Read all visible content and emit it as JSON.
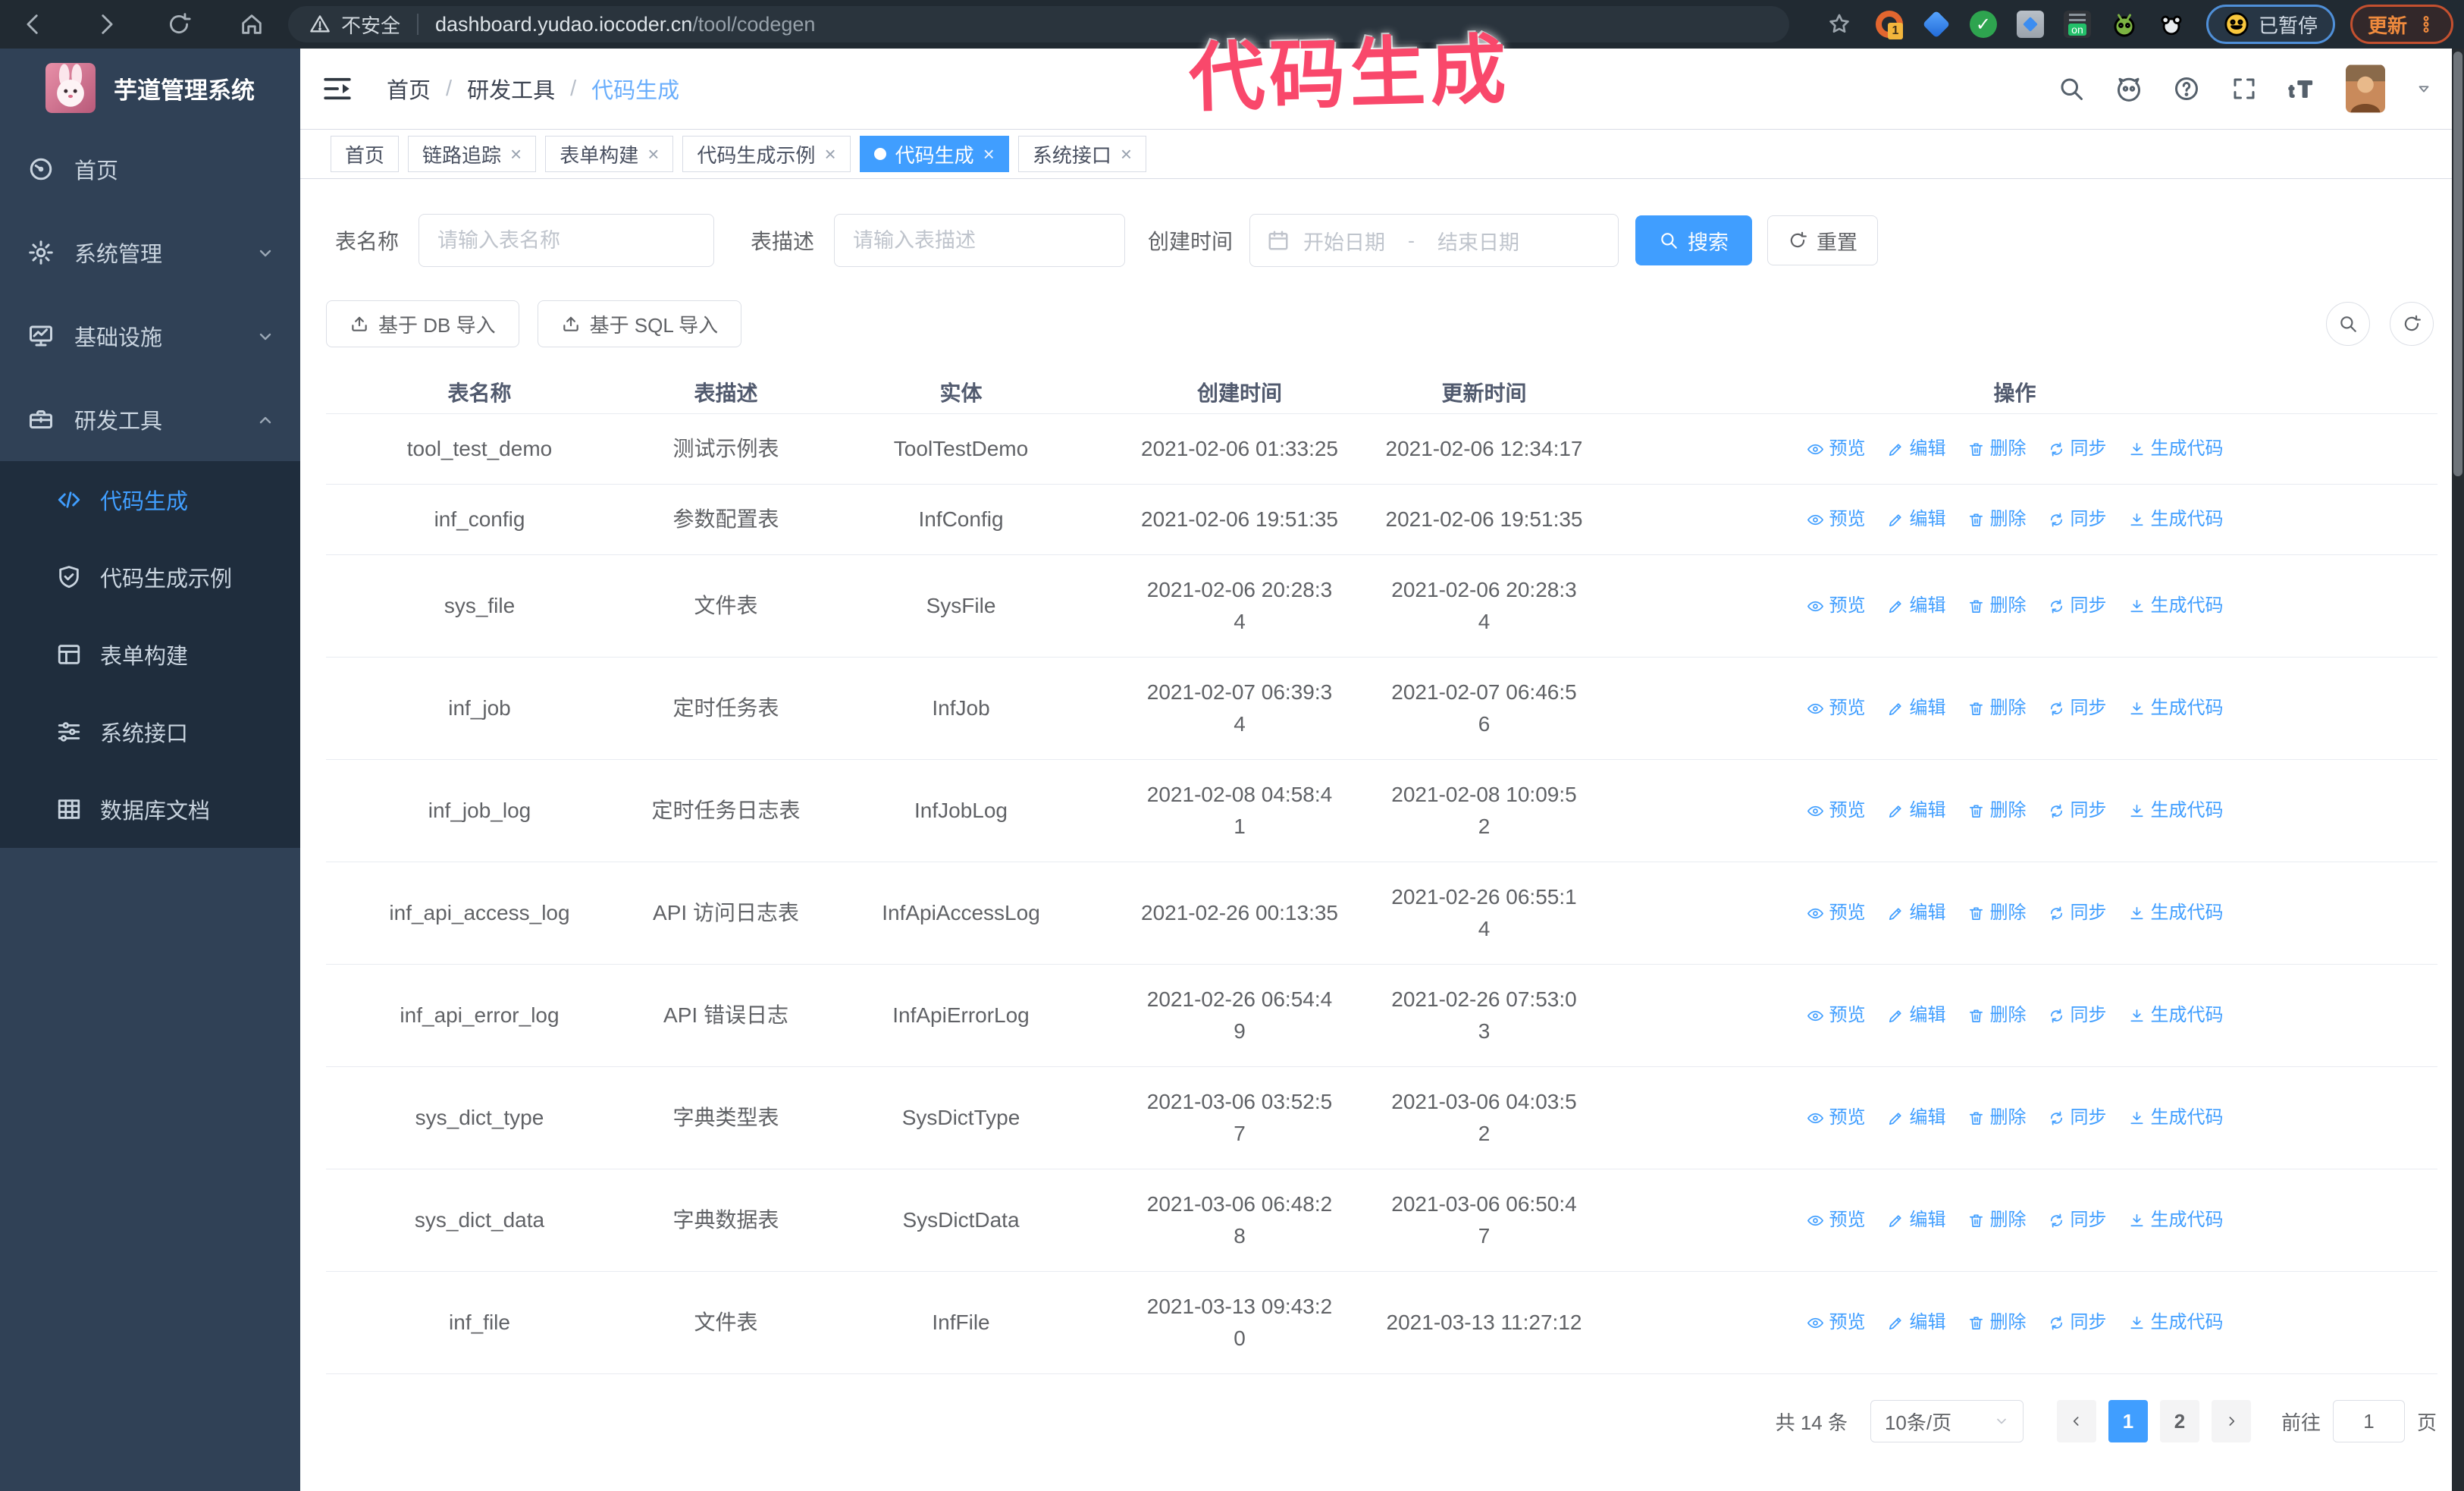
{
  "browser": {
    "security_label": "不安全",
    "url_domain": "dashboard.yudao.iocoder.cn",
    "url_path": "/tool/codegen",
    "paused_label": "已暂停",
    "update_label": "更新",
    "extension_icons": [
      "orange-ring",
      "blue-gem",
      "green-check",
      "gray-grid",
      "panel-on",
      "green-bot",
      "white-paw"
    ]
  },
  "annotation": {
    "text": "代码生成",
    "color": "#f9486b"
  },
  "sidebar": {
    "title": "芋道管理系统",
    "items": [
      {
        "label": "首页",
        "icon": "dashboard",
        "key": "home",
        "expandable": false,
        "expanded": false,
        "active": false
      },
      {
        "label": "系统管理",
        "icon": "gear",
        "key": "system",
        "expandable": true,
        "expanded": false,
        "active": false
      },
      {
        "label": "基础设施",
        "icon": "monitor",
        "key": "infra",
        "expandable": true,
        "expanded": false,
        "active": false
      },
      {
        "label": "研发工具",
        "icon": "toolbox",
        "key": "devtools",
        "expandable": true,
        "expanded": true,
        "active": false
      }
    ],
    "submenu": [
      {
        "label": "代码生成",
        "icon": "code",
        "key": "codegen",
        "active": true
      },
      {
        "label": "代码生成示例",
        "icon": "shield",
        "key": "codegen-example",
        "active": false
      },
      {
        "label": "表单构建",
        "icon": "form",
        "key": "form-builder",
        "active": false
      },
      {
        "label": "系统接口",
        "icon": "sliders",
        "key": "system-api",
        "active": false
      },
      {
        "label": "数据库文档",
        "icon": "dbgrid",
        "key": "db-doc",
        "active": false
      }
    ]
  },
  "header": {
    "breadcrumb": [
      "首页",
      "研发工具",
      "代码生成"
    ],
    "tabs": [
      {
        "label": "首页",
        "closable": false,
        "active": false
      },
      {
        "label": "链路追踪",
        "closable": true,
        "active": false
      },
      {
        "label": "表单构建",
        "closable": true,
        "active": false
      },
      {
        "label": "代码生成示例",
        "closable": true,
        "active": false
      },
      {
        "label": "代码生成",
        "closable": true,
        "active": true
      },
      {
        "label": "系统接口",
        "closable": true,
        "active": false
      }
    ]
  },
  "filters": {
    "table_name_label": "表名称",
    "table_name_placeholder": "请输入表名称",
    "table_desc_label": "表描述",
    "table_desc_placeholder": "请输入表描述",
    "create_time_label": "创建时间",
    "date_start_placeholder": "开始日期",
    "date_separator": "-",
    "date_end_placeholder": "结束日期",
    "search_label": "搜索",
    "reset_label": "重置"
  },
  "toolbar": {
    "import_db_label": "基于 DB 导入",
    "import_sql_label": "基于 SQL 导入"
  },
  "table": {
    "columns": [
      "表名称",
      "表描述",
      "实体",
      "创建时间",
      "更新时间",
      "操作"
    ],
    "actions": [
      "预览",
      "编辑",
      "删除",
      "同步",
      "生成代码"
    ],
    "action_keys": [
      "preview",
      "edit",
      "delete",
      "sync",
      "generate-code"
    ],
    "action_icons": [
      "eye",
      "edit",
      "trash",
      "sync",
      "download"
    ],
    "rows": [
      {
        "name": "tool_test_demo",
        "desc": "测试示例表",
        "entity": "ToolTestDemo",
        "created": [
          "2021-02-06 01:33:25"
        ],
        "updated": [
          "2021-02-06 12:34:17"
        ]
      },
      {
        "name": "inf_config",
        "desc": "参数配置表",
        "entity": "InfConfig",
        "created": [
          "2021-02-06 19:51:35"
        ],
        "updated": [
          "2021-02-06 19:51:35"
        ]
      },
      {
        "name": "sys_file",
        "desc": "文件表",
        "entity": "SysFile",
        "created": [
          "2021-02-06 20:28:3",
          "4"
        ],
        "updated": [
          "2021-02-06 20:28:3",
          "4"
        ]
      },
      {
        "name": "inf_job",
        "desc": "定时任务表",
        "entity": "InfJob",
        "created": [
          "2021-02-07 06:39:3",
          "4"
        ],
        "updated": [
          "2021-02-07 06:46:5",
          "6"
        ]
      },
      {
        "name": "inf_job_log",
        "desc": "定时任务日志表",
        "entity": "InfJobLog",
        "created": [
          "2021-02-08 04:58:4",
          "1"
        ],
        "updated": [
          "2021-02-08 10:09:5",
          "2"
        ]
      },
      {
        "name": "inf_api_access_log",
        "desc": "API 访问日志表",
        "entity": "InfApiAccessLog",
        "created": [
          "2021-02-26 00:13:35"
        ],
        "updated": [
          "2021-02-26 06:55:1",
          "4"
        ]
      },
      {
        "name": "inf_api_error_log",
        "desc": "API 错误日志",
        "entity": "InfApiErrorLog",
        "created": [
          "2021-02-26 06:54:4",
          "9"
        ],
        "updated": [
          "2021-02-26 07:53:0",
          "3"
        ]
      },
      {
        "name": "sys_dict_type",
        "desc": "字典类型表",
        "entity": "SysDictType",
        "created": [
          "2021-03-06 03:52:5",
          "7"
        ],
        "updated": [
          "2021-03-06 04:03:5",
          "2"
        ]
      },
      {
        "name": "sys_dict_data",
        "desc": "字典数据表",
        "entity": "SysDictData",
        "created": [
          "2021-03-06 06:48:2",
          "8"
        ],
        "updated": [
          "2021-03-06 06:50:4",
          "7"
        ]
      },
      {
        "name": "inf_file",
        "desc": "文件表",
        "entity": "InfFile",
        "created": [
          "2021-03-13 09:43:2",
          "0"
        ],
        "updated": [
          "2021-03-13 11:27:12"
        ]
      }
    ]
  },
  "pagination": {
    "total_text": "共 14 条",
    "page_size": "10条/页",
    "pages": [
      "1",
      "2"
    ],
    "active_page": "1",
    "goto_label": "前往",
    "goto_value": "1",
    "goto_suffix": "页"
  },
  "colors": {
    "primary": "#409EFF",
    "sidebar_bg": "#304156",
    "submenu_bg": "#1f2d3d",
    "chrome_bg": "#212a32",
    "annotation": "#f9486b",
    "pagination_btn_bg": "#f4f4f5",
    "table_border": "#e8ebf1"
  }
}
